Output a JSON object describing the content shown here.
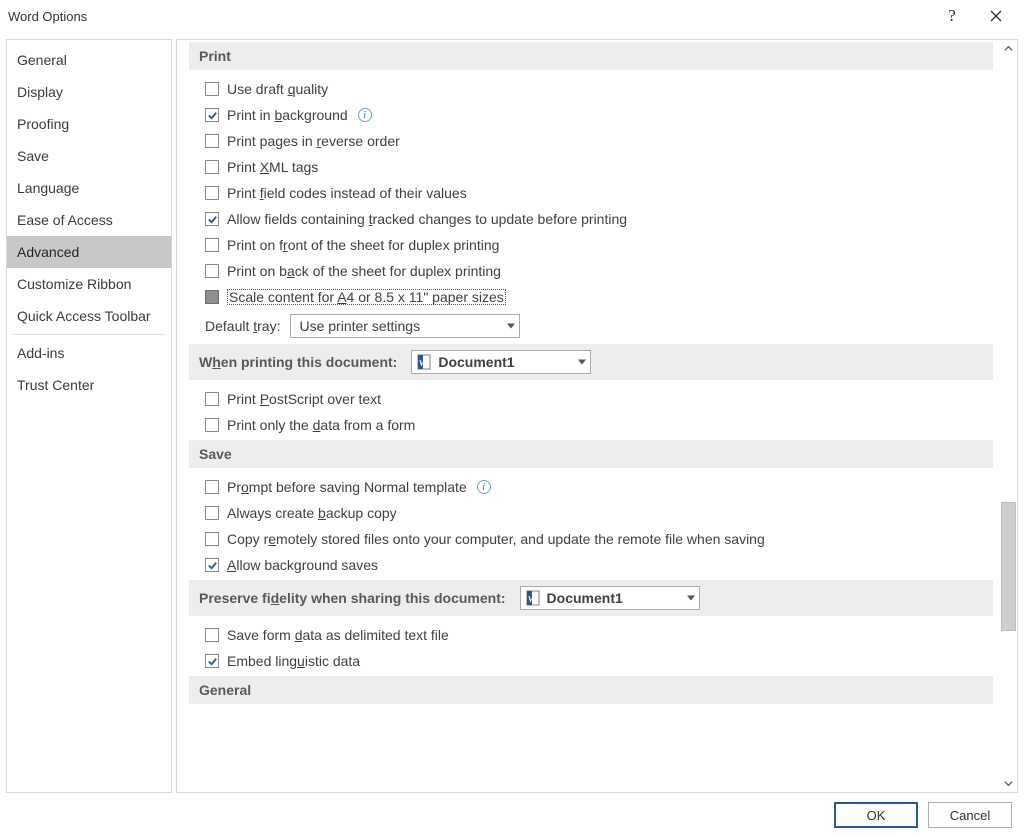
{
  "window": {
    "title": "Word Options"
  },
  "sidebar": {
    "items": [
      {
        "label": "General"
      },
      {
        "label": "Display"
      },
      {
        "label": "Proofing"
      },
      {
        "label": "Save"
      },
      {
        "label": "Language"
      },
      {
        "label": "Ease of Access"
      },
      {
        "label": "Advanced",
        "selected": true
      },
      {
        "label": "Customize Ribbon"
      },
      {
        "label": "Quick Access Toolbar"
      },
      {
        "label": "Add-ins"
      },
      {
        "label": "Trust Center"
      }
    ]
  },
  "sections": {
    "print": {
      "title": "Print",
      "draft": "Use draft quality",
      "background": "Print in background",
      "reverse": "Print pages in reverse order",
      "xml": "Print XML tags",
      "fieldcodes": "Print field codes instead of their values",
      "tracked": "Allow fields containing tracked changes to update before printing",
      "front": "Print on front of the sheet for duplex printing",
      "back": "Print on back of the sheet for duplex printing",
      "scale": "Scale content for A4 or 8.5 x 11\" paper sizes",
      "tray_label": "Default tray:",
      "tray_value": "Use printer settings"
    },
    "printdoc": {
      "title": "When printing this document:",
      "doc": "Document1",
      "postscript": "Print PostScript over text",
      "onlydata": "Print only the data from a form"
    },
    "save": {
      "title": "Save",
      "prompt": "Prompt before saving Normal template",
      "backup": "Always create backup copy",
      "remote": "Copy remotely stored files onto your computer, and update the remote file when saving",
      "bgsaves": "Allow background saves"
    },
    "fidelity": {
      "title": "Preserve fidelity when sharing this document:",
      "doc": "Document1",
      "formdata": "Save form data as delimited text file",
      "linguistic": "Embed linguistic data"
    },
    "general": {
      "title": "General"
    }
  },
  "footer": {
    "ok": "OK",
    "cancel": "Cancel"
  }
}
